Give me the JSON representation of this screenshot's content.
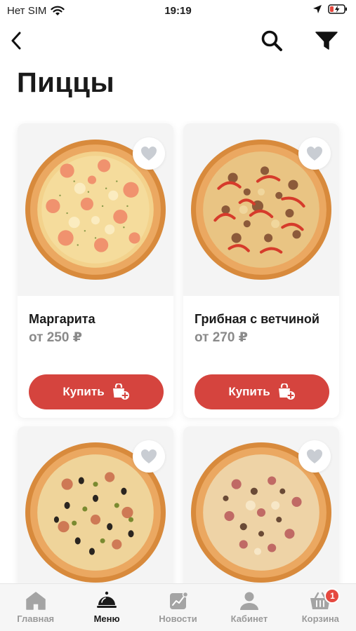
{
  "status_bar": {
    "carrier": "Нет SIM",
    "time": "19:19",
    "icons": [
      "wifi-icon",
      "location-arrow-icon",
      "battery-charging-icon"
    ]
  },
  "nav": {
    "icons": [
      "back-arrow-icon",
      "search-icon",
      "filter-icon"
    ]
  },
  "page": {
    "title": "Пиццы"
  },
  "products": [
    {
      "name": "Маргарита",
      "price": "от 250 ₽",
      "buy_label": "Купить",
      "favorite": false
    },
    {
      "name": "Грибная с ветчиной",
      "price": "от 270 ₽",
      "buy_label": "Купить",
      "favorite": false
    },
    {
      "name": "",
      "price": "",
      "buy_label": "",
      "favorite": false
    },
    {
      "name": "",
      "price": "",
      "buy_label": "",
      "favorite": false
    }
  ],
  "tab_bar": {
    "tabs": [
      {
        "label": "Главная",
        "icon": "home-icon"
      },
      {
        "label": "Меню",
        "icon": "serving-tray-icon"
      },
      {
        "label": "Новости",
        "icon": "news-chart-icon"
      },
      {
        "label": "Кабинет",
        "icon": "user-icon"
      },
      {
        "label": "Корзина",
        "icon": "basket-icon"
      }
    ],
    "active": "Меню",
    "cart_badge": "1"
  },
  "colors": {
    "accent": "#d5443e",
    "badge": "#e5483f",
    "price_gray": "#8a8a8a",
    "tab_inactive": "#9a9a9a"
  }
}
